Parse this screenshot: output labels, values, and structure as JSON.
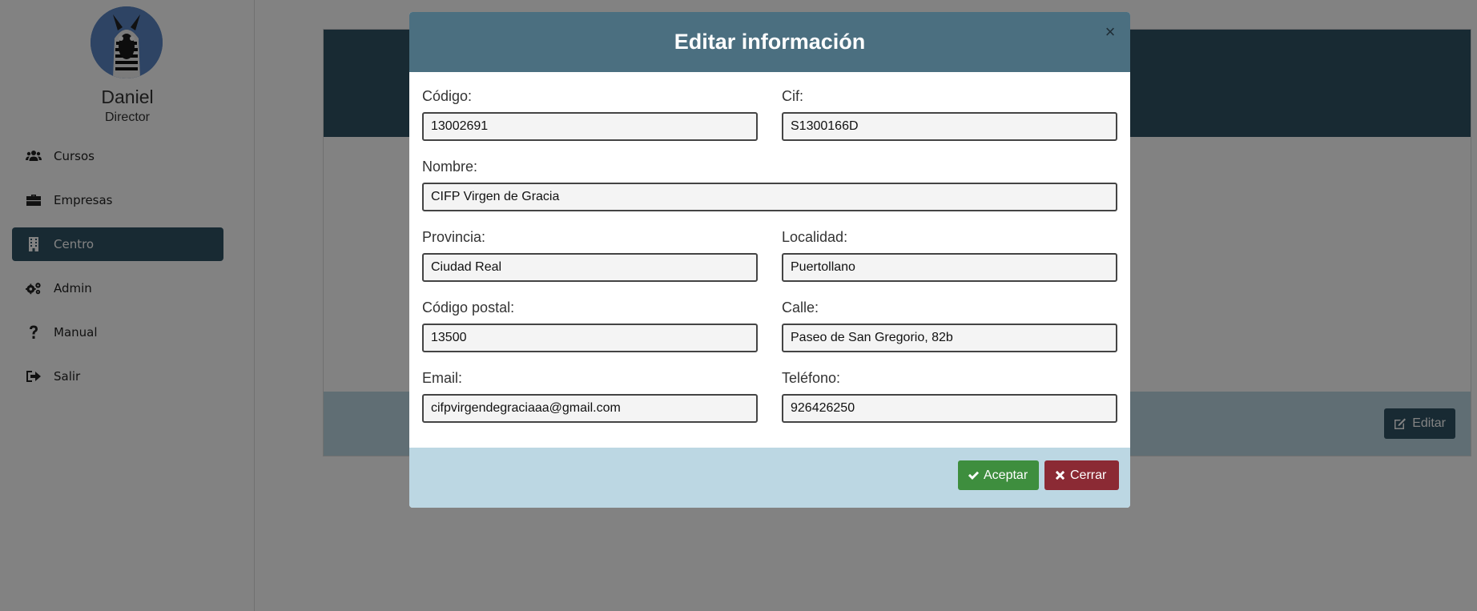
{
  "sidebar": {
    "user_name": "Daniel",
    "user_role": "Director",
    "items": [
      {
        "label": "Cursos",
        "icon": "users-icon"
      },
      {
        "label": "Empresas",
        "icon": "briefcase-icon"
      },
      {
        "label": "Centro",
        "icon": "building-icon",
        "active": true
      },
      {
        "label": "Admin",
        "icon": "cogs-icon"
      },
      {
        "label": "Manual",
        "icon": "question-icon"
      },
      {
        "label": "Salir",
        "icon": "sign-out-icon"
      }
    ]
  },
  "main": {
    "edit_label": "Editar"
  },
  "modal": {
    "title": "Editar información",
    "close_symbol": "×",
    "fields": {
      "codigo": {
        "label": "Código:",
        "value": "13002691"
      },
      "cif": {
        "label": "Cif:",
        "value": "S1300166D"
      },
      "nombre": {
        "label": "Nombre:",
        "value": "CIFP Virgen de Gracia"
      },
      "provincia": {
        "label": "Provincia:",
        "value": "Ciudad Real"
      },
      "localidad": {
        "label": "Localidad:",
        "value": "Puertollano"
      },
      "codigo_postal": {
        "label": "Código postal:",
        "value": "13500"
      },
      "calle": {
        "label": "Calle:",
        "value": "Paseo de San Gregorio, 82b"
      },
      "email": {
        "label": "Email:",
        "value": "cifpvirgendegraciaaa@gmail.com"
      },
      "telefono": {
        "label": "Teléfono:",
        "value": "926426250"
      }
    },
    "accept_label": "Aceptar",
    "cancel_label": "Cerrar"
  },
  "colors": {
    "primary": "#2f5365",
    "modal_header": "#4b6f80",
    "footer_bg": "#bcd7e3",
    "accept": "#3e8e3e",
    "cancel": "#8b2a34"
  }
}
